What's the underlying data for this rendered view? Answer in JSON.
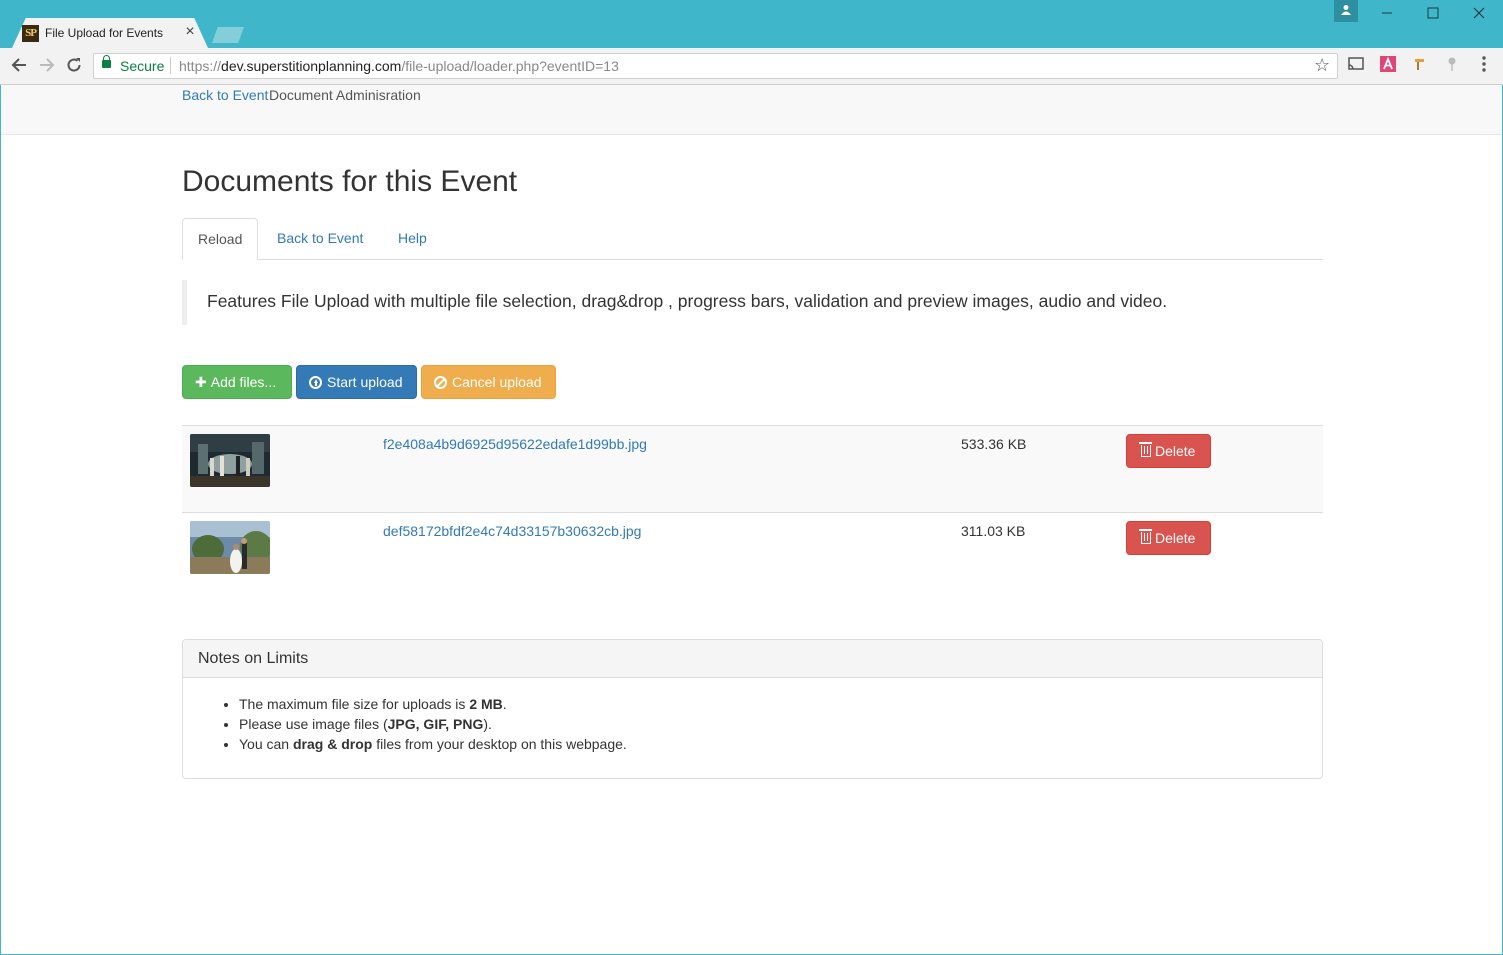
{
  "browser": {
    "tab_title": "File Upload for Events",
    "tab_favicon": "SP",
    "tab_close": "×",
    "secure_label": "Secure",
    "url_scheme": "https://",
    "url_host": "dev.superstitionplanning.com",
    "url_path": "/file-upload/loader.php?eventID=13"
  },
  "navbar": {
    "back_link": "Back to Event",
    "brand": "Document Adminisration"
  },
  "page": {
    "title": "Documents for this Event",
    "tabs": [
      "Reload",
      "Back to Event",
      "Help"
    ],
    "active_tab": "Reload",
    "description": "Features File Upload with multiple file selection, drag&drop , progress bars, validation and preview images, audio and video."
  },
  "actions": {
    "add_files": "Add files...",
    "start_upload": "Start upload",
    "cancel_upload": "Cancel upload"
  },
  "files": [
    {
      "name": "f2e408a4b9d6925d95622edafe1d99bb.jpg",
      "size": "533.36 KB",
      "delete_label": "Delete"
    },
    {
      "name": "def58172bfdf2e4c74d33157b30632cb.jpg",
      "size": "311.03 KB",
      "delete_label": "Delete"
    }
  ],
  "notes": {
    "heading": "Notes on Limits",
    "item1_pre": "The maximum file size for uploads is ",
    "item1_bold": "2 MB",
    "item1_post": ".",
    "item2_pre": "Please use image files (",
    "item2_bold": "JPG, GIF, PNG",
    "item2_post": ").",
    "item3_pre": "You can ",
    "item3_bold": "drag & drop",
    "item3_post": " files from your desktop on this webpage."
  },
  "colors": {
    "titlebar": "#3fb6c9",
    "link": "#337ab7",
    "success": "#5cb85c",
    "primary": "#337ab7",
    "warning": "#f0ad4e",
    "danger": "#d9534f"
  }
}
